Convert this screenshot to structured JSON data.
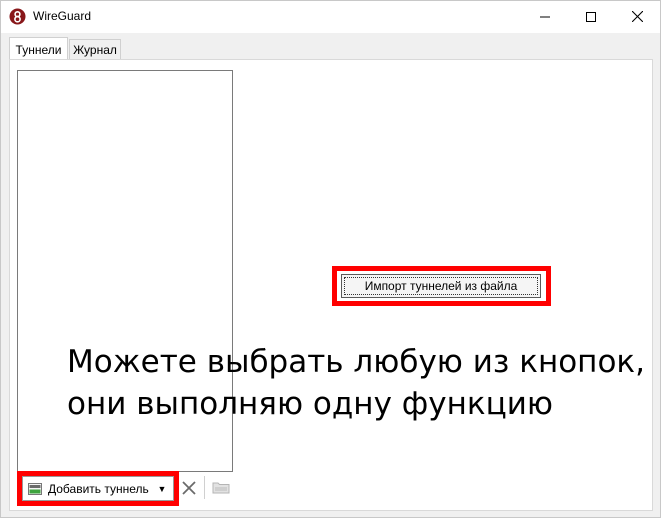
{
  "window": {
    "title": "WireGuard"
  },
  "tabs": [
    {
      "label": "Туннели",
      "active": true
    },
    {
      "label": "Журнал",
      "active": false
    }
  ],
  "main": {
    "import_button_label": "Импорт туннелей из файла",
    "add_tunnel_label": "Добавить туннель"
  },
  "annotation": {
    "line1": "Можете выбрать любую из кнопок,",
    "line2": "они выполняю одну функцию"
  },
  "icons": {
    "app": "wireguard-logo-icon",
    "minimize": "minimize-icon",
    "maximize": "maximize-icon",
    "close": "close-icon",
    "add": "add-tunnel-icon",
    "dropdown": "chevron-down-icon",
    "delete": "delete-icon",
    "export": "export-folder-icon"
  },
  "colors": {
    "highlight": "#ff0000",
    "logo": "#88171a"
  }
}
